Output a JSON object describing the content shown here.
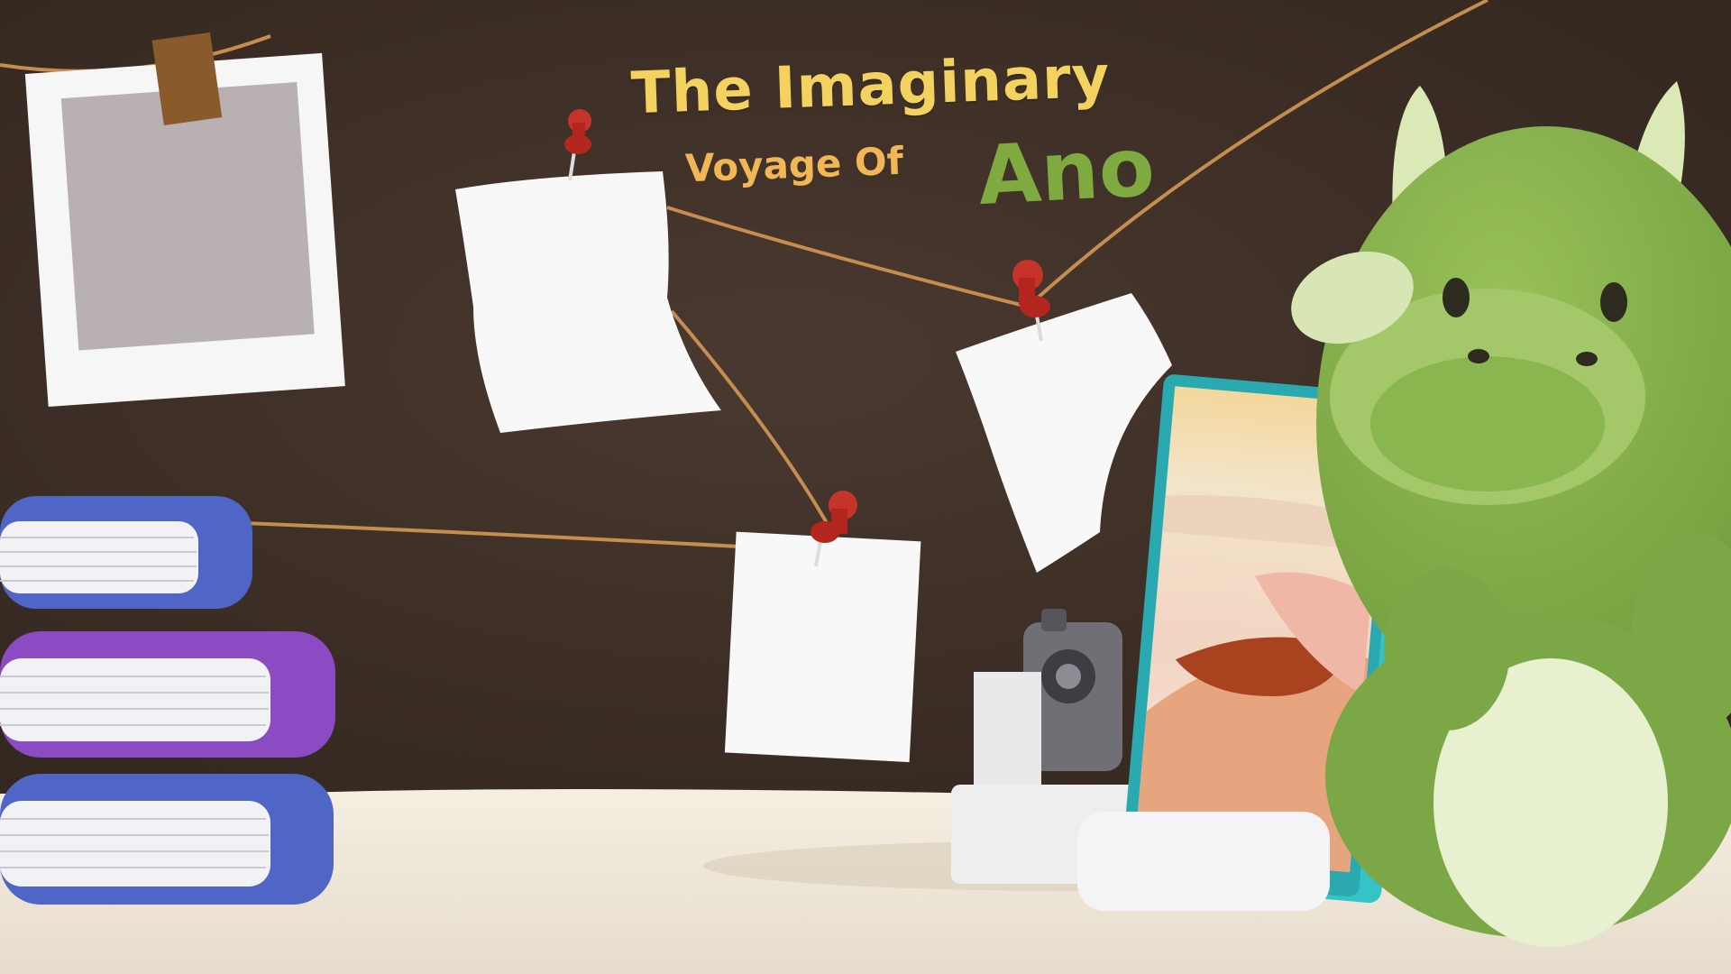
{
  "title": {
    "line1": "The Imaginary",
    "line2": "Voyage Of",
    "line3": "Ano"
  },
  "colors": {
    "background_wall": "#3f3029",
    "string": "#c58d4e",
    "desk": "#efe7d9",
    "title_yellow": "#f4d25f",
    "title_orange": "#f1b655",
    "title_green": "#7faa3f",
    "dragon_green": "#86b24a",
    "phone_frame": "#35c3c8",
    "book_blue": "#4f66c7",
    "book_purple": "#8b4bc2",
    "pin_red": "#b3261e"
  }
}
